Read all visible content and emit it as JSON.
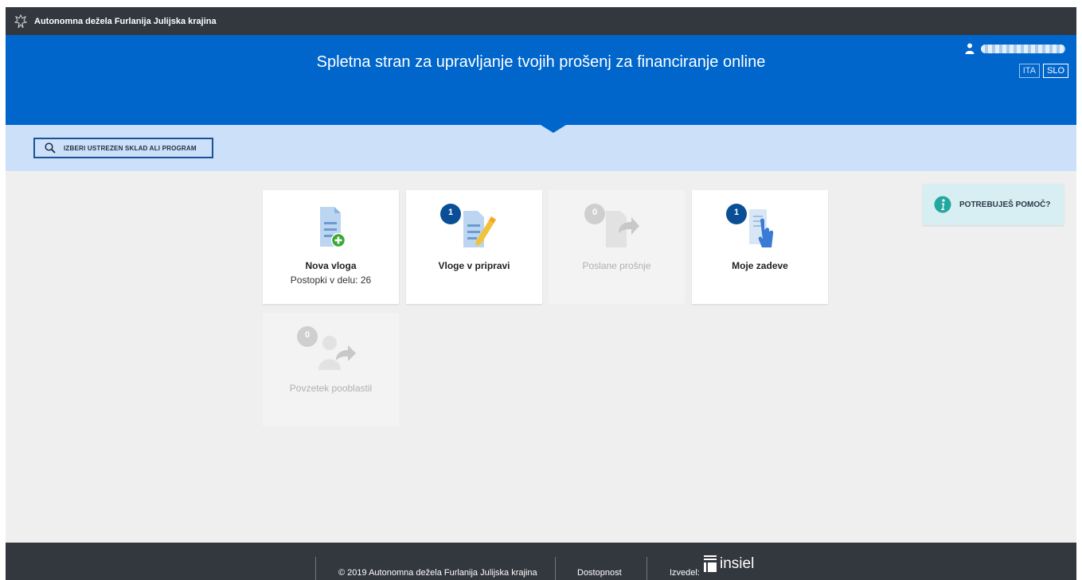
{
  "topbar": {
    "region_name": "Autonomna dežela Furlanija Julijska krajina"
  },
  "header": {
    "title": "Spletna stran za upravljanje tvojih prošenj za financiranje online",
    "languages": [
      "ITA",
      "SLO"
    ],
    "active_language": "SLO"
  },
  "search": {
    "label": "IZBERI USTREZEN SKLAD ALI PROGRAM"
  },
  "tiles": [
    {
      "label": "Nova vloga",
      "sub": "Postopki v delu: 26",
      "icon": "document-add-icon",
      "enabled": true
    },
    {
      "label": "Vloge v pripravi",
      "badge": "1",
      "icon": "document-edit-icon",
      "enabled": true
    },
    {
      "label": "Poslane prošnje",
      "badge": "0",
      "icon": "document-send-icon",
      "enabled": false
    },
    {
      "label": "Moje zadeve",
      "badge": "1",
      "icon": "hand-document-icon",
      "enabled": true
    },
    {
      "label": "Povzetek pooblastil",
      "badge": "0",
      "icon": "person-share-icon",
      "enabled": false
    }
  ],
  "help": {
    "label": "POTREBUJEŠ POMOČ?",
    "icon": "info-icon"
  },
  "footer": {
    "copyright": "© 2019 Autonomna dežela Furlanija Julijska krajina",
    "accessibility": "Dostopnost",
    "made_by_label": "Izvedel:",
    "vendor": "insiel"
  },
  "colors": {
    "header_blue": "#0066cc",
    "search_band": "#cce0fa",
    "dark_bar": "#33373e",
    "badge_blue": "#0a4f96",
    "help_bg": "#d7eff2"
  }
}
